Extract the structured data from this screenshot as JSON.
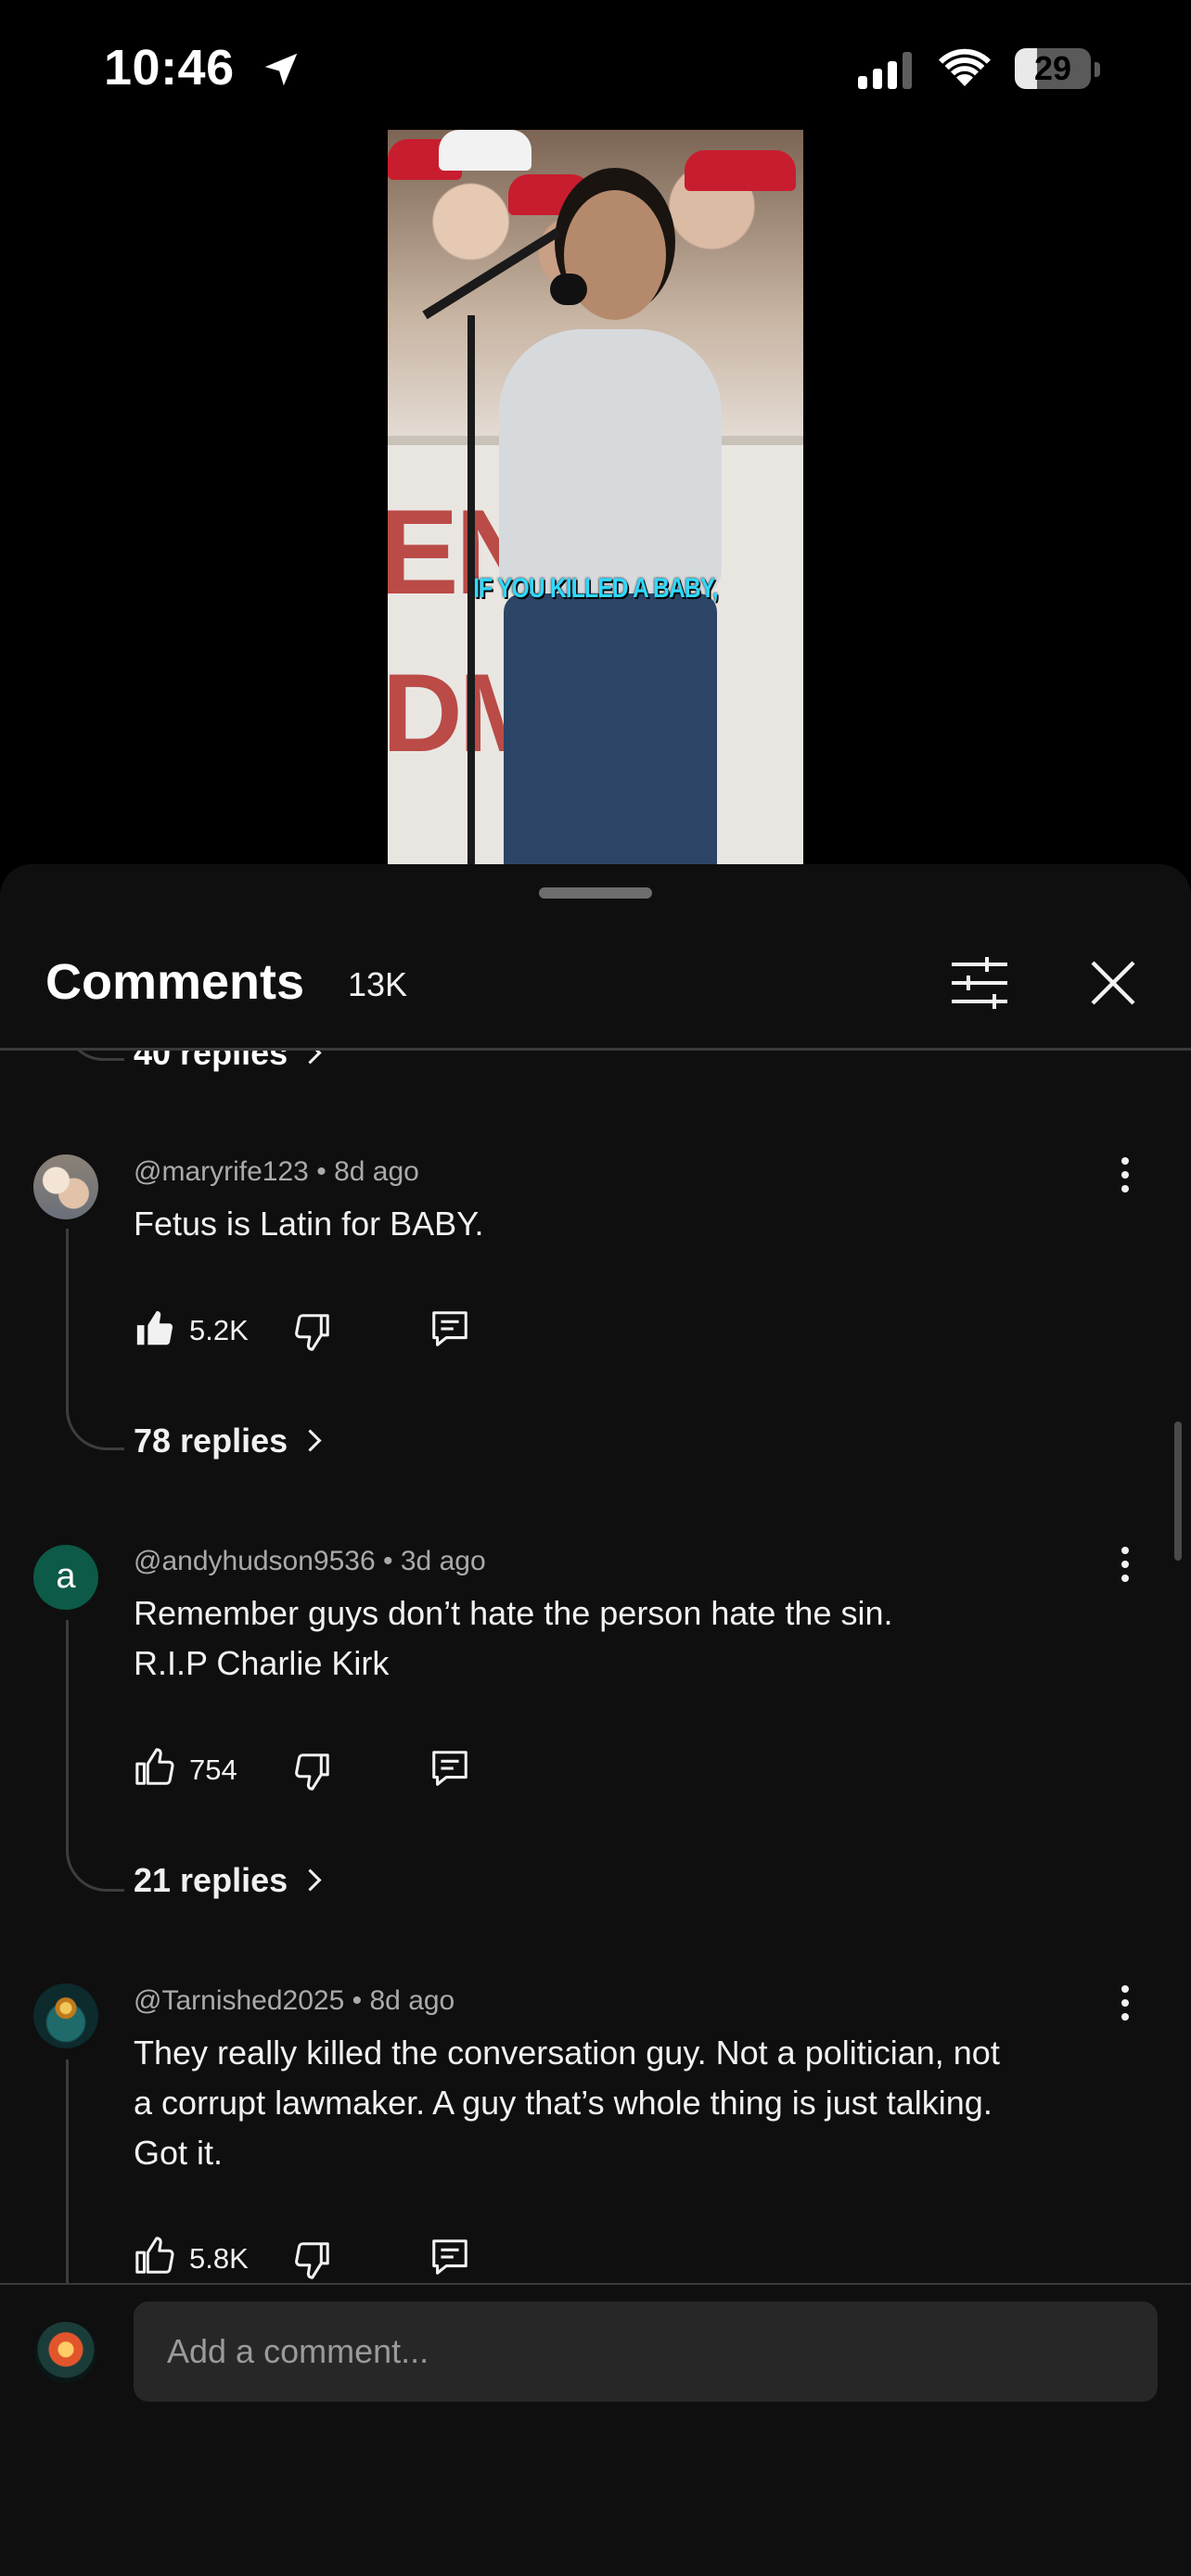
{
  "status_bar": {
    "time": "10:46",
    "battery": "29",
    "battery_level": 0.29
  },
  "video": {
    "caption": "IF YOU KILLED A BABY,"
  },
  "comments": {
    "title": "Comments",
    "count": "13K",
    "previous_thread_replies": "40 replies",
    "items": [
      {
        "handle": "@maryrife123",
        "age": "8d ago",
        "lines": [
          "Fetus is Latin for BABY."
        ],
        "likes": "5.2K",
        "liked": true,
        "replies": "78 replies"
      },
      {
        "handle": "@andyhudson9536",
        "age": "3d ago",
        "avatar_letter": "a",
        "lines": [
          "Remember guys don’t hate the person hate the sin.",
          "R.I.P Charlie Kirk"
        ],
        "likes": "754",
        "liked": false,
        "replies": "21 replies"
      },
      {
        "handle": "@Tarnished2025",
        "age": "8d ago",
        "lines": [
          "They really killed the conversation guy. Not a politician, not",
          "a corrupt lawmaker. A guy that’s whole thing is just talking.",
          "Got it."
        ],
        "likes": "5.8K",
        "liked": false
      }
    ],
    "separator": "•"
  },
  "composer": {
    "placeholder": "Add a comment..."
  },
  "colors": {
    "sheet": "#0f0f0f",
    "text": "#f1f1f1",
    "meta": "#aaaaaa",
    "input": "#272727"
  }
}
